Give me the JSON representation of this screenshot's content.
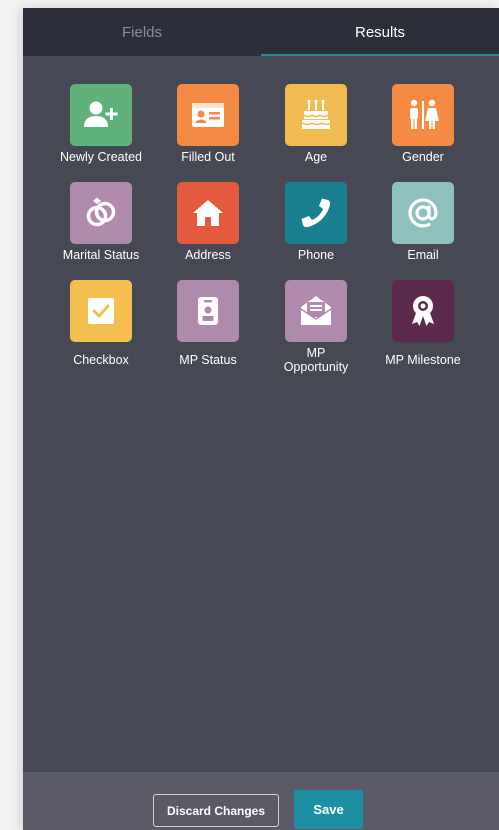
{
  "tabs": [
    {
      "label": "Fields",
      "active": false
    },
    {
      "label": "Results",
      "active": true
    }
  ],
  "tiles": [
    {
      "label": "Newly Created",
      "icon": "add-user-icon",
      "color": "#5fb37a"
    },
    {
      "label": "Filled Out",
      "icon": "id-card-icon",
      "color": "#f58a45"
    },
    {
      "label": "Age",
      "icon": "birthday-cake-icon",
      "color": "#f0bb50"
    },
    {
      "label": "Gender",
      "icon": "restroom-icon",
      "color": "#f58a45"
    },
    {
      "label": "Marital Status",
      "icon": "rings-icon",
      "color": "#b08aac"
    },
    {
      "label": "Address",
      "icon": "home-icon",
      "color": "#e35a3e"
    },
    {
      "label": "Phone",
      "icon": "phone-icon",
      "color": "#1a7f8e"
    },
    {
      "label": "Email",
      "icon": "at-sign-icon",
      "color": "#8cc1bd"
    },
    {
      "label": "Checkbox",
      "icon": "checkbox-icon",
      "color": "#f4bf50"
    },
    {
      "label": "MP Status",
      "icon": "badge-icon",
      "color": "#b08aac"
    },
    {
      "label": "MP\nOpportunity",
      "icon": "envelope-open-icon",
      "color": "#b08aac"
    },
    {
      "label": "MP Milestone",
      "icon": "award-ribbon-icon",
      "color": "#5d2a4e"
    }
  ],
  "footer": {
    "discard_label": "Discard Changes",
    "save_label": "Save"
  }
}
